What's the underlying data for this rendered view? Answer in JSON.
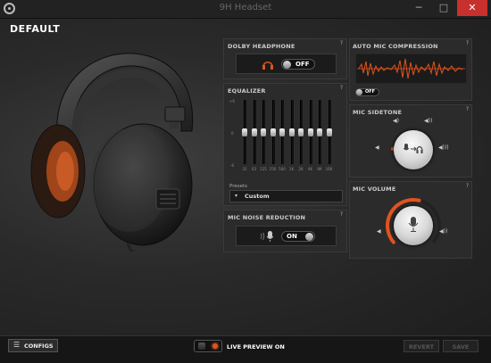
{
  "window": {
    "title": "9H Headset",
    "minimize": "─",
    "maximize": "□",
    "close": "✕"
  },
  "profile": {
    "name": "DEFAULT"
  },
  "dolby": {
    "title": "DOLBY HEADPHONE",
    "help": "?",
    "toggle": "OFF"
  },
  "auto_mic": {
    "title": "AUTO MIC COMPRESSION",
    "help": "?",
    "toggle": "OFF"
  },
  "equalizer": {
    "title": "EQUALIZER",
    "help": "?",
    "db_labels": [
      "+6",
      "0",
      "-6"
    ],
    "bands": [
      "31",
      "63",
      "125",
      "250",
      "500",
      "1K",
      "2K",
      "4K",
      "8K",
      "16K"
    ],
    "gains": [
      0,
      0,
      0,
      0,
      0,
      0,
      0,
      0,
      0,
      0
    ],
    "presets_label": "Presets",
    "preset_value": "Custom"
  },
  "noise_reduction": {
    "title": "MIC NOISE REDUCTION",
    "help": "?",
    "toggle": "ON"
  },
  "sidetone": {
    "title": "MIC SIDETONE",
    "help": "?"
  },
  "mic_volume": {
    "title": "MIC VOLUME",
    "help": "?",
    "level": 0.55
  },
  "footer": {
    "configs": "CONFIGS",
    "live_preview": "LIVE PREVIEW ON",
    "revert": "REVERT",
    "save": "SAVE"
  },
  "colors": {
    "accent": "#e0531f",
    "panel": "#2b2b2b",
    "close": "#c7302c"
  }
}
